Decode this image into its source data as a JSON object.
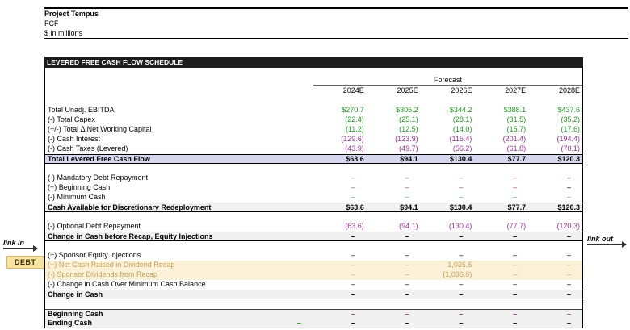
{
  "header": {
    "title": "Project Tempus",
    "sheet": "FCF",
    "units": "$ in millions"
  },
  "annotations": {
    "link_in": "link in",
    "link_out": "link out",
    "debt_badge": "DEBT"
  },
  "colors": {
    "link_green": "#229922",
    "link_purple": "#993399",
    "recap_tan": "#c5a059",
    "subtotal_lavender_bg": "#d6d6ee",
    "subtotal_gray_bg": "#f0f0f0",
    "recap_yellow_bg": "#faf1d7",
    "section_bar_bg": "#1c1c1c",
    "debt_badge_bg": "#f8e2a0"
  },
  "table": {
    "section_title": "LEVERED FREE CASH FLOW SCHEDULE",
    "forecast_label": "Forecast",
    "years": [
      "2024E",
      "2025E",
      "2026E",
      "2027E",
      "2028E"
    ],
    "rows": [
      {
        "label": "Total Unadj. EBITDA",
        "style": "",
        "vals": [
          [
            "$270.7",
            "green"
          ],
          [
            "$305.2",
            "green"
          ],
          [
            "$344.2",
            "green"
          ],
          [
            "$388.1",
            "green"
          ],
          [
            "$437.6",
            "green"
          ]
        ]
      },
      {
        "label": "(-) Total Capex",
        "style": "",
        "vals": [
          [
            "(22.4)",
            "green"
          ],
          [
            "(25.1)",
            "green"
          ],
          [
            "(28.1)",
            "green"
          ],
          [
            "(31.5)",
            "green"
          ],
          [
            "(35.2)",
            "green"
          ]
        ]
      },
      {
        "label": "(+/-) Total Δ Net Working Capital",
        "style": "",
        "vals": [
          [
            "(11.2)",
            "green"
          ],
          [
            "(12.5)",
            "green"
          ],
          [
            "(14.0)",
            "green"
          ],
          [
            "(15.7)",
            "green"
          ],
          [
            "(17.6)",
            "green"
          ]
        ]
      },
      {
        "label": "(-) Cash Interest",
        "style": "",
        "vals": [
          [
            "(129.6)",
            "purple"
          ],
          [
            "(123.9)",
            "purple"
          ],
          [
            "(115.4)",
            "purple"
          ],
          [
            "(201.4)",
            "purple"
          ],
          [
            "(194.4)",
            "purple"
          ]
        ]
      },
      {
        "label": "(-) Cash Taxes (Levered)",
        "style": "",
        "vals": [
          [
            "(43.9)",
            "purple"
          ],
          [
            "(49.7)",
            "purple"
          ],
          [
            "(56.2)",
            "purple"
          ],
          [
            "(61.8)",
            "purple"
          ],
          [
            "(70.1)",
            "purple"
          ]
        ]
      },
      {
        "label": "Total Levered Free Cash Flow",
        "style": "subtotal lavender",
        "vals": [
          [
            "$63.6",
            "black"
          ],
          [
            "$94.1",
            "black"
          ],
          [
            "$130.4",
            "black"
          ],
          [
            "$77.7",
            "black"
          ],
          [
            "$120.3",
            "black"
          ]
        ]
      },
      {
        "style": ""
      },
      {
        "label": "(-) Mandatory Debt Repayment",
        "style": "",
        "vals": [
          [
            "–",
            "purple"
          ],
          [
            "–",
            "purple"
          ],
          [
            "–",
            "purple"
          ],
          [
            "–",
            "purple"
          ],
          [
            "–",
            "purple"
          ]
        ]
      },
      {
        "label": "(+) Beginning Cash",
        "style": "",
        "vals": [
          [
            "–",
            "purple"
          ],
          [
            "–",
            "purple"
          ],
          [
            "–",
            "purple"
          ],
          [
            "–",
            "purple"
          ],
          [
            "–",
            "black"
          ]
        ]
      },
      {
        "label": "(-) Minimum Cash",
        "style": "",
        "vals": [
          [
            "–",
            "green"
          ],
          [
            "–",
            "green"
          ],
          [
            "–",
            "green"
          ],
          [
            "–",
            "green"
          ],
          [
            "–",
            "green"
          ]
        ]
      },
      {
        "label": "Cash Available for Discretionary Redeployment",
        "style": "subtotal gray",
        "vals": [
          [
            "$63.6",
            "black"
          ],
          [
            "$94.1",
            "black"
          ],
          [
            "$130.4",
            "black"
          ],
          [
            "$77.7",
            "black"
          ],
          [
            "$120.3",
            "black"
          ]
        ]
      },
      {
        "style": ""
      },
      {
        "label": "(-) Optional Debt Repayment",
        "style": "",
        "vals": [
          [
            "(63.6)",
            "purple"
          ],
          [
            "(94.1)",
            "purple"
          ],
          [
            "(130.4)",
            "purple"
          ],
          [
            "(77.7)",
            "purple"
          ],
          [
            "(120.3)",
            "purple"
          ]
        ]
      },
      {
        "label": "Change in Cash before Recap, Equity Injections",
        "style": "subtotal gray",
        "vals": [
          [
            "–",
            "black"
          ],
          [
            "–",
            "black"
          ],
          [
            "–",
            "black"
          ],
          [
            "–",
            "black"
          ],
          [
            "–",
            "black"
          ]
        ]
      },
      {
        "style": ""
      },
      {
        "label": "(+) Sponsor Equity Injections",
        "style": "",
        "vals": [
          [
            "–",
            "black"
          ],
          [
            "–",
            "black"
          ],
          [
            "–",
            "black"
          ],
          [
            "–",
            "black"
          ],
          [
            "–",
            "black"
          ]
        ]
      },
      {
        "label": "(+) Net Cash Raised in Dividend Recap",
        "style": "yellow",
        "label_color": "tan",
        "vals": [
          [
            "–",
            "tan"
          ],
          [
            "–",
            "tan"
          ],
          [
            "1,036.6",
            "tan"
          ],
          [
            "–",
            "tan"
          ],
          [
            "–",
            "tan"
          ]
        ]
      },
      {
        "label": "(-) Sponsor Dividends from Recap",
        "style": "yellow",
        "label_color": "tan",
        "vals": [
          [
            "–",
            "tan"
          ],
          [
            "–",
            "tan"
          ],
          [
            "(1,036.6)",
            "tan"
          ],
          [
            "–",
            "tan"
          ],
          [
            "–",
            "tan"
          ]
        ]
      },
      {
        "label": "(-) Change in Cash Over Minimum Cash Balance",
        "style": "",
        "vals": [
          [
            "–",
            "black"
          ],
          [
            "–",
            "black"
          ],
          [
            "–",
            "black"
          ],
          [
            "–",
            "black"
          ],
          [
            "–",
            "black"
          ]
        ]
      },
      {
        "label": "Change in Cash",
        "style": "subtotal gray",
        "vals": [
          [
            "–",
            "black"
          ],
          [
            "–",
            "black"
          ],
          [
            "–",
            "black"
          ],
          [
            "–",
            "black"
          ],
          [
            "–",
            "black"
          ]
        ]
      },
      {
        "style": ""
      },
      {
        "label": "Beginning Cash",
        "style": "cash-block bt",
        "vals": [
          [
            "–",
            "purple"
          ],
          [
            "–",
            "purple"
          ],
          [
            "–",
            "purple"
          ],
          [
            "–",
            "purple"
          ],
          [
            "–",
            "purple"
          ]
        ]
      },
      {
        "label": "Ending Cash",
        "style": "cash-block bb",
        "pf": [
          "–",
          "green"
        ],
        "vals": [
          [
            "–",
            "black"
          ],
          [
            "–",
            "black"
          ],
          [
            "–",
            "black"
          ],
          [
            "–",
            "black"
          ],
          [
            "–",
            "black"
          ]
        ]
      }
    ]
  }
}
